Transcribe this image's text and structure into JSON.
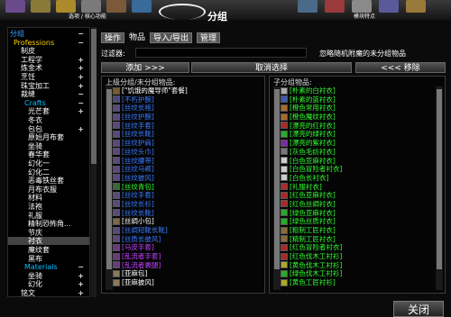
{
  "topbar": {
    "left_label": "选项 / 核心功能",
    "right_label": "模块特点"
  },
  "title": "分组",
  "tabs": [
    {
      "label": "操作"
    },
    {
      "label": "物品"
    },
    {
      "label": "导入/导出"
    },
    {
      "label": "管理"
    }
  ],
  "filter": {
    "label": "过滤器:",
    "value": "",
    "note": "忽略随机附魔的未分组物品"
  },
  "buttons": {
    "add": "添加 >>>",
    "cancel": "取消选择",
    "remove": "<<< 移除",
    "close": "关闭"
  },
  "sidebar": [
    {
      "label": "分组",
      "color": "#3aa0ff",
      "indent": 0,
      "sign": "−"
    },
    {
      "label": "Professions",
      "color": "#ffd100",
      "indent": 4,
      "sign": "−"
    },
    {
      "label": "制皮",
      "color": "#ffffff",
      "indent": 12,
      "sign": ""
    },
    {
      "label": "工程学",
      "color": "#ffffff",
      "indent": 12,
      "sign": "+"
    },
    {
      "label": "炼金术",
      "color": "#ffffff",
      "indent": 12,
      "sign": "+"
    },
    {
      "label": "烹饪",
      "color": "#ffffff",
      "indent": 12,
      "sign": "+"
    },
    {
      "label": "珠宝加工",
      "color": "#ffffff",
      "indent": 12,
      "sign": "+"
    },
    {
      "label": "裁缝",
      "color": "#ffffff",
      "indent": 12,
      "sign": "−"
    },
    {
      "label": "Crafts",
      "color": "#00c0ff",
      "indent": 16,
      "sign": "−"
    },
    {
      "label": "光芒套",
      "color": "#ffffff",
      "indent": 20,
      "sign": "+"
    },
    {
      "label": "冬衣",
      "color": "#ffffff",
      "indent": 20,
      "sign": ""
    },
    {
      "label": "包包",
      "color": "#ffffff",
      "indent": 20,
      "sign": "+"
    },
    {
      "label": "原始月布套",
      "color": "#ffffff",
      "indent": 20,
      "sign": ""
    },
    {
      "label": "坐骑",
      "color": "#ffffff",
      "indent": 20,
      "sign": ""
    },
    {
      "label": "春华套",
      "color": "#ffffff",
      "indent": 20,
      "sign": ""
    },
    {
      "label": "幻化一",
      "color": "#ffffff",
      "indent": 20,
      "sign": ""
    },
    {
      "label": "幻化二",
      "color": "#ffffff",
      "indent": 20,
      "sign": ""
    },
    {
      "label": "恶毒铁丝套",
      "color": "#ffffff",
      "indent": 20,
      "sign": ""
    },
    {
      "label": "月布衣服",
      "color": "#ffffff",
      "indent": 20,
      "sign": ""
    },
    {
      "label": "材料",
      "color": "#ffffff",
      "indent": 20,
      "sign": ""
    },
    {
      "label": "法袍",
      "color": "#ffffff",
      "indent": 20,
      "sign": ""
    },
    {
      "label": "礼服",
      "color": "#ffffff",
      "indent": 20,
      "sign": ""
    },
    {
      "label": "精制恐怖角...",
      "color": "#ffffff",
      "indent": 20,
      "sign": ""
    },
    {
      "label": "节庆",
      "color": "#ffffff",
      "indent": 20,
      "sign": ""
    },
    {
      "label": "衬衣",
      "color": "#ffffff",
      "indent": 20,
      "sign": "",
      "selected": true
    },
    {
      "label": "魔纹套",
      "color": "#ffffff",
      "indent": 20,
      "sign": ""
    },
    {
      "label": "黑布",
      "color": "#ffffff",
      "indent": 20,
      "sign": ""
    },
    {
      "label": "Materials",
      "color": "#00c0ff",
      "indent": 16,
      "sign": "−"
    },
    {
      "label": "坐骑",
      "color": "#ffffff",
      "indent": 20,
      "sign": "+"
    },
    {
      "label": "幻化",
      "color": "#ffffff",
      "indent": 20,
      "sign": "+"
    },
    {
      "label": "铭文",
      "color": "#ffffff",
      "indent": 12,
      "sign": "+"
    }
  ],
  "left_panel": {
    "title": "上级分组/未分组物品:",
    "items": [
      {
        "name": "[\"饥饿的魔导师\"套餐]",
        "color": "#ffffff",
        "icon": "#7a5a2a"
      },
      {
        "name": "[不朽护腕]",
        "color": "#3a7aff",
        "icon": "#4a4a7a"
      },
      {
        "name": "[丝纹长袍]",
        "color": "#3a7aff",
        "icon": "#5a4a7a"
      },
      {
        "name": "[丝纹护腕]",
        "color": "#3a7aff",
        "icon": "#5a4a7a"
      },
      {
        "name": "[丝纹手套]",
        "color": "#3a7aff",
        "icon": "#5a4a7a"
      },
      {
        "name": "[丝纹长靴]",
        "color": "#3a7aff",
        "icon": "#5a4a7a"
      },
      {
        "name": "[丝纹护肩]",
        "color": "#3a7aff",
        "icon": "#5a4a7a"
      },
      {
        "name": "[丝纹头巾]",
        "color": "#3a7aff",
        "icon": "#5a4a7a"
      },
      {
        "name": "[丝纹腰带]",
        "color": "#3a7aff",
        "icon": "#5a4a7a"
      },
      {
        "name": "[丝纹马裤]",
        "color": "#3a7aff",
        "icon": "#5a4a7a"
      },
      {
        "name": "[丝纹披风]",
        "color": "#3a7aff",
        "icon": "#5a4a7a"
      },
      {
        "name": "[丝纹青包]",
        "color": "#30ff30",
        "icon": "#3a6a3a"
      },
      {
        "name": "[丝纹手套]",
        "color": "#3a7aff",
        "icon": "#5a4a7a"
      },
      {
        "name": "[丝纹长衫]",
        "color": "#3a7aff",
        "icon": "#5a4a7a"
      },
      {
        "name": "[丝纹长靴]",
        "color": "#3a7aff",
        "icon": "#5a4a7a"
      },
      {
        "name": "[丝绸小包]",
        "color": "#ffffff",
        "icon": "#7a6a4a"
      },
      {
        "name": "[丝绸短靴长靴]",
        "color": "#3a7aff",
        "icon": "#5a4a7a"
      },
      {
        "name": "[丝质长披风]",
        "color": "#3a7aff",
        "icon": "#5a4a7a"
      },
      {
        "name": "[马皮手套]",
        "color": "#c040ff",
        "icon": "#6a3a7a"
      },
      {
        "name": "[乱流者手套]",
        "color": "#c040ff",
        "icon": "#6a3a7a"
      },
      {
        "name": "[乱流者裹腿]",
        "color": "#c040ff",
        "icon": "#6a3a7a"
      },
      {
        "name": "[亚麻包]",
        "color": "#ffffff",
        "icon": "#8a7a5a"
      },
      {
        "name": "[亚麻披风]",
        "color": "#ffffff",
        "icon": "#8a7a5a"
      }
    ]
  },
  "right_panel": {
    "title": "子分组物品:",
    "items": [
      {
        "name": "[朴素的白衬衣]",
        "color": "#30ff30",
        "icon": "#aaaaaa"
      },
      {
        "name": "[朴素的蓝衬衣]",
        "color": "#30ff30",
        "icon": "#3a5aaa"
      },
      {
        "name": "[橙色常用衬衣]",
        "color": "#30ff30",
        "icon": "#aa6a2a"
      },
      {
        "name": "[橙色魔纹衬衣]",
        "color": "#30ff30",
        "icon": "#aa6a2a"
      },
      {
        "name": "[漂亮的红衬衣]",
        "color": "#30ff30",
        "icon": "#aa2a2a"
      },
      {
        "name": "[漂亮的绿衬衣]",
        "color": "#30ff30",
        "icon": "#2aaa2a"
      },
      {
        "name": "[漂亮的紫衬衣]",
        "color": "#30ff30",
        "icon": "#7a2aaa"
      },
      {
        "name": "[灰色毛纺衬衣]",
        "color": "#30ff30",
        "icon": "#777777"
      },
      {
        "name": "[白色亚麻衬衣]",
        "color": "#30ff30",
        "icon": "#cccccc"
      },
      {
        "name": "[白色冒险者衬衣]",
        "color": "#30ff30",
        "icon": "#cccccc"
      },
      {
        "name": "[白色长衬衣]",
        "color": "#30ff30",
        "icon": "#cccccc"
      },
      {
        "name": "[礼服衬衣]",
        "color": "#30ff30",
        "icon": "#aa2a2a"
      },
      {
        "name": "[红色亚麻衬衣]",
        "color": "#30ff30",
        "icon": "#aa2a2a"
      },
      {
        "name": "[红色丝绸衬衣]",
        "color": "#30ff30",
        "icon": "#aa2a2a"
      },
      {
        "name": "[绿色亚麻衬衣]",
        "color": "#30ff30",
        "icon": "#2aaa2a"
      },
      {
        "name": "[绿色丝质衬衣]",
        "color": "#30ff30",
        "icon": "#2aaa2a"
      },
      {
        "name": "[粗制工匠衬衣]",
        "color": "#30ff30",
        "icon": "#8a6a3a"
      },
      {
        "name": "[精制工匠衬衣]",
        "color": "#30ff30",
        "icon": "#8a6a3a"
      },
      {
        "name": "[红色冒险者衬衣]",
        "color": "#30ff30",
        "icon": "#aa2a2a"
      },
      {
        "name": "[红色伐木工衬衫]",
        "color": "#30ff30",
        "icon": "#aa2a2a"
      },
      {
        "name": "[黄色伐木工衬衫]",
        "color": "#30ff30",
        "icon": "#aaaa2a"
      },
      {
        "name": "[绿色伐木工衬衫]",
        "color": "#30ff30",
        "icon": "#2aaa2a"
      },
      {
        "name": "[黄色工匠衬衫]",
        "color": "#30ff30",
        "icon": "#aaaa2a"
      }
    ]
  }
}
